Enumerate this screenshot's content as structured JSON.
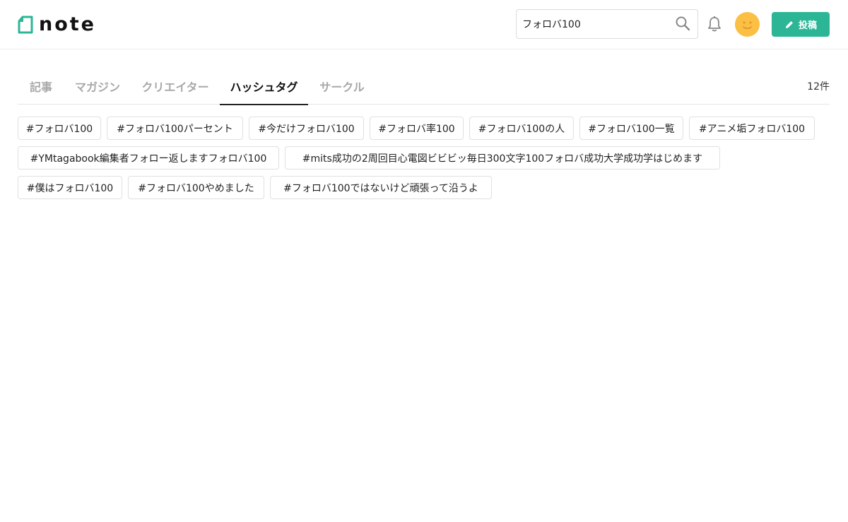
{
  "brand": {
    "name": "note",
    "accent": "#2cb696"
  },
  "search": {
    "value": "フォロバ100",
    "icon": "search-icon"
  },
  "header": {
    "notifications_icon": "bell-icon",
    "avatar_icon": "smiley-face-icon",
    "post_label": "投稿",
    "post_icon": "pencil-icon"
  },
  "tabs": [
    {
      "label": "記事",
      "active": false
    },
    {
      "label": "マガジン",
      "active": false
    },
    {
      "label": "クリエイター",
      "active": false
    },
    {
      "label": "ハッシュタグ",
      "active": true
    },
    {
      "label": "サークル",
      "active": false
    }
  ],
  "result_count": "12件",
  "hashtags": [
    "#フォロバ100",
    "#フォロバ100パーセント",
    "#今だけフォロバ100",
    "#フォロバ率100",
    "#フォロバ100の人",
    "#フォロバ100一覧",
    "#アニメ垢フォロバ100",
    "#YMtagabook編集者フォロー返しますフォロバ100",
    "#mits成功の2周回目心電図ビビビッ毎日300文字100フォロバ成功大学成功学はじめます",
    "#僕はフォロバ100",
    "#フォロバ100やめました",
    "#フォロバ100ではないけど頑張って沿うよ"
  ]
}
